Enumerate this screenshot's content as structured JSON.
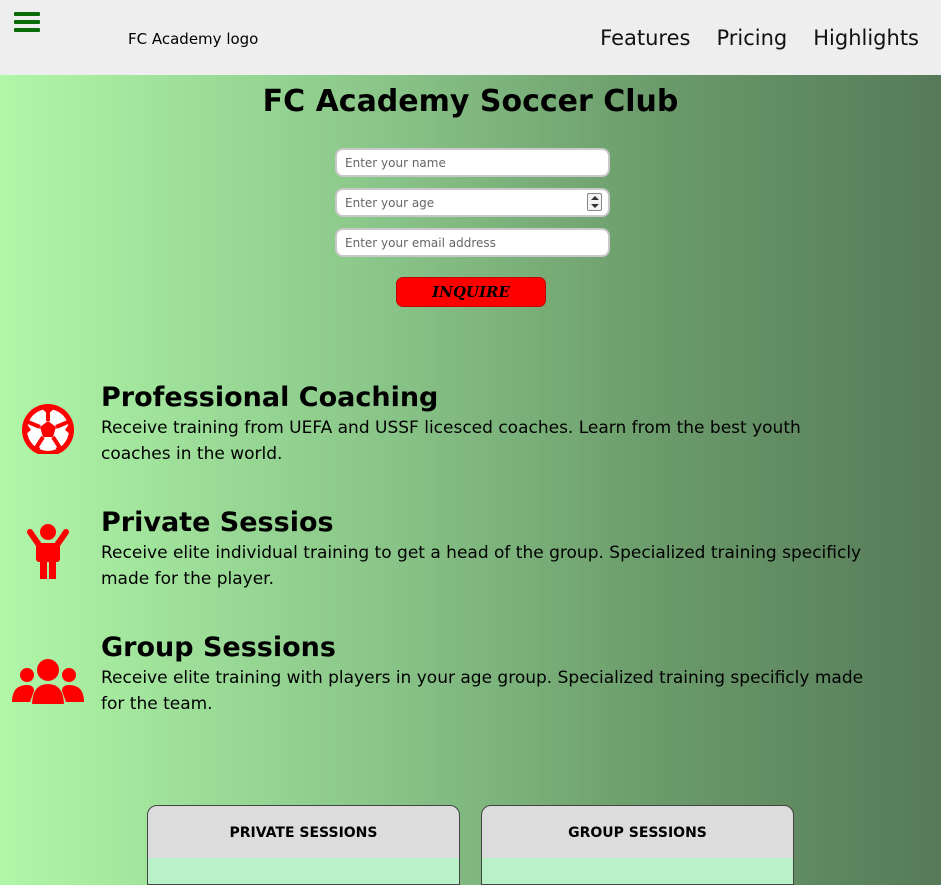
{
  "header": {
    "logo_text": "FC Academy logo",
    "nav": [
      "Features",
      "Pricing",
      "Highlights"
    ]
  },
  "hero": {
    "title": "FC Academy Soccer Club"
  },
  "form": {
    "name_placeholder": "Enter your name",
    "age_placeholder": "Enter your age",
    "email_placeholder": "Enter your email address",
    "submit_label": "INQUIRE"
  },
  "features": [
    {
      "title": "Professional Coaching",
      "text": "Receive training from UEFA and USSF licesced coaches. Learn from the best youth coaches in the world.",
      "icon": "soccer-ball-icon"
    },
    {
      "title": "Private Sessios",
      "text": "Receive elite individual training to get a head of the group. Specialized training specificly made for the player.",
      "icon": "person-icon"
    },
    {
      "title": "Group Sessions",
      "text": "Receive elite training with players in your age group. Specialized training specificly made for the team.",
      "icon": "group-icon"
    }
  ],
  "pricing": {
    "cards": [
      "PRIVATE SESSIONS",
      "GROUP SESSIONS"
    ]
  },
  "colors": {
    "accent": "#ff0000",
    "menu_icon": "#0b6b0b",
    "header_bg": "#eeeeee"
  }
}
